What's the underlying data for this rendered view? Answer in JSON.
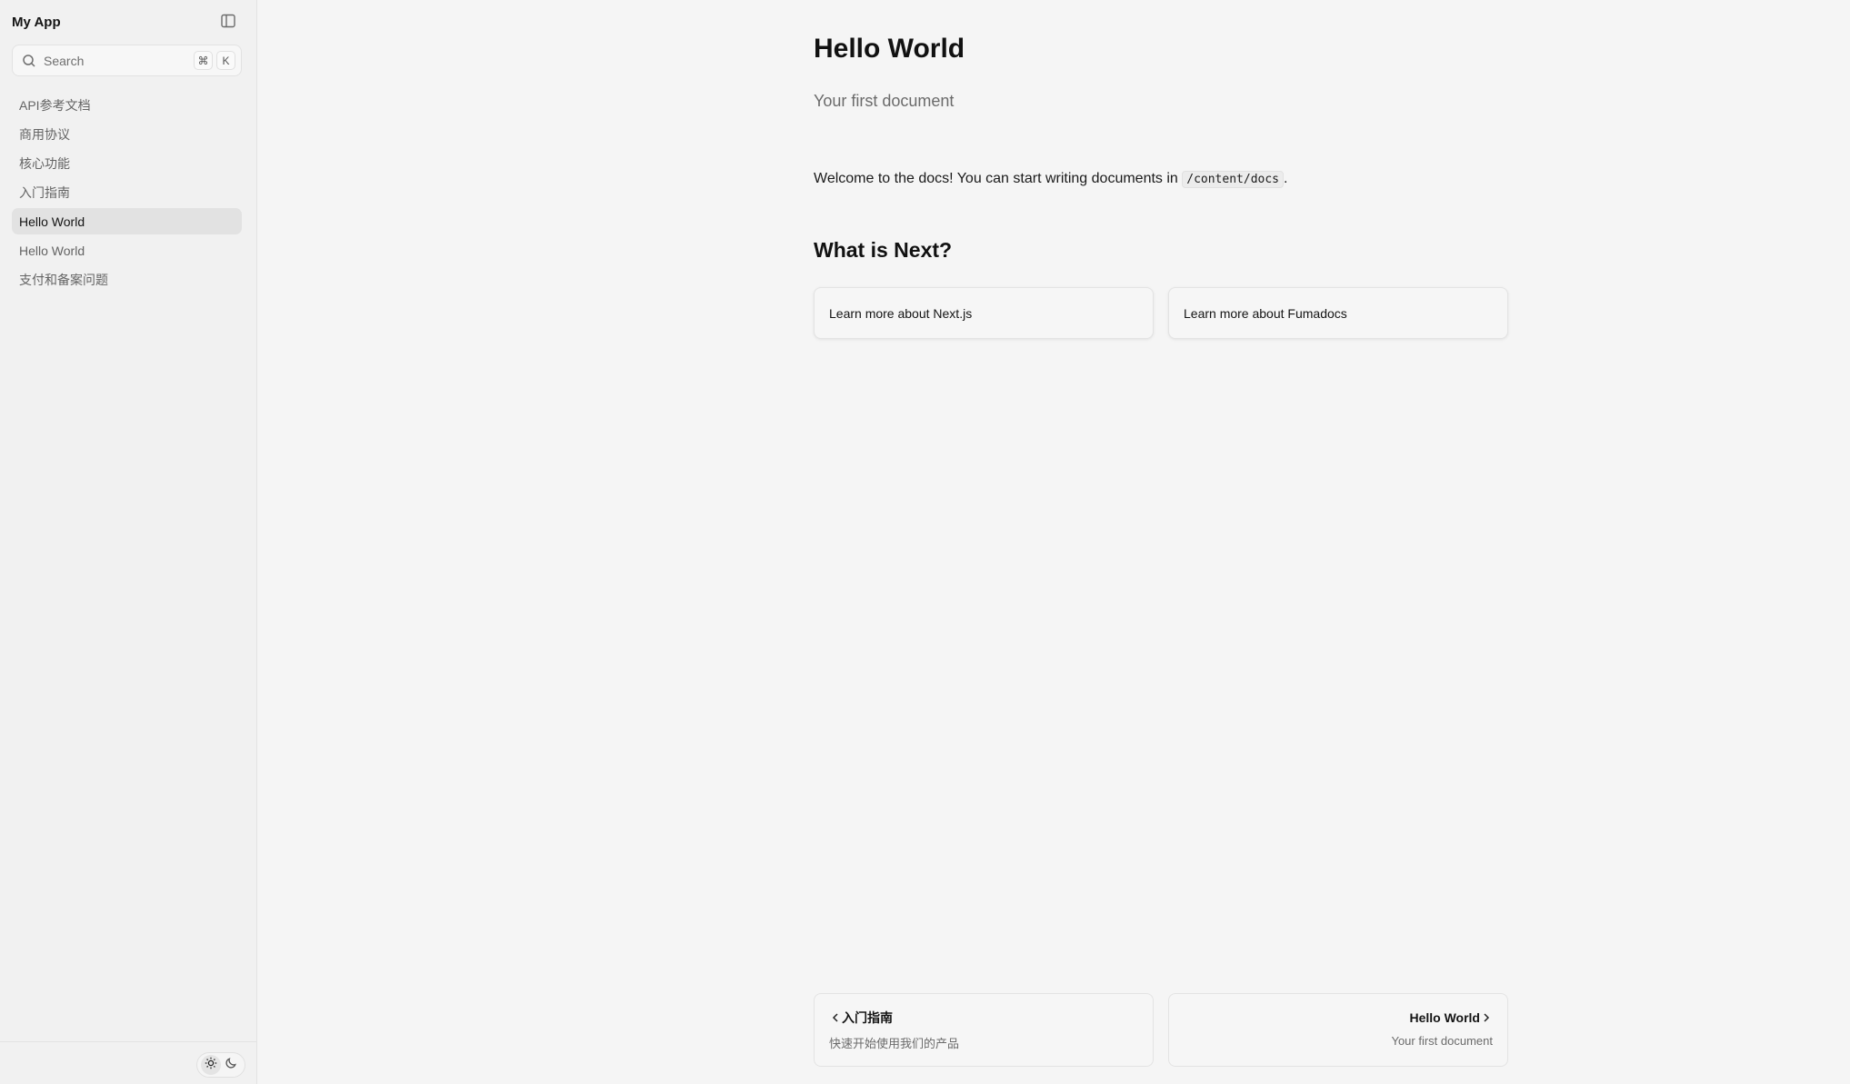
{
  "app": {
    "title": "My App"
  },
  "search": {
    "placeholder": "Search",
    "shortcut_mod": "⌘",
    "shortcut_key": "K"
  },
  "sidebar": {
    "items": [
      {
        "label": "API参考文档",
        "active": false
      },
      {
        "label": "商用协议",
        "active": false
      },
      {
        "label": "核心功能",
        "active": false
      },
      {
        "label": "入门指南",
        "active": false
      },
      {
        "label": "Hello World",
        "active": true
      },
      {
        "label": "Hello World",
        "active": false
      },
      {
        "label": "支付和备案问题",
        "active": false
      }
    ]
  },
  "page": {
    "title": "Hello World",
    "subtitle": "Your first document",
    "intro_before": "Welcome to the docs! You can start writing documents in ",
    "intro_code": "/content/docs",
    "intro_after": ".",
    "section_title": "What is Next?",
    "cards": [
      {
        "label": "Learn more about Next.js"
      },
      {
        "label": "Learn more about Fumadocs"
      }
    ]
  },
  "pager": {
    "prev": {
      "title": "入门指南",
      "description": "快速开始使用我们的产品"
    },
    "next": {
      "title": "Hello World",
      "description": "Your first document"
    }
  },
  "theme": {
    "active": "light"
  },
  "colors": {
    "background": "#f5f5f5",
    "sidebar": "#f1f1f1",
    "active_item": "#e2e2e2",
    "text": "#141414",
    "muted": "#6b6b6b"
  }
}
